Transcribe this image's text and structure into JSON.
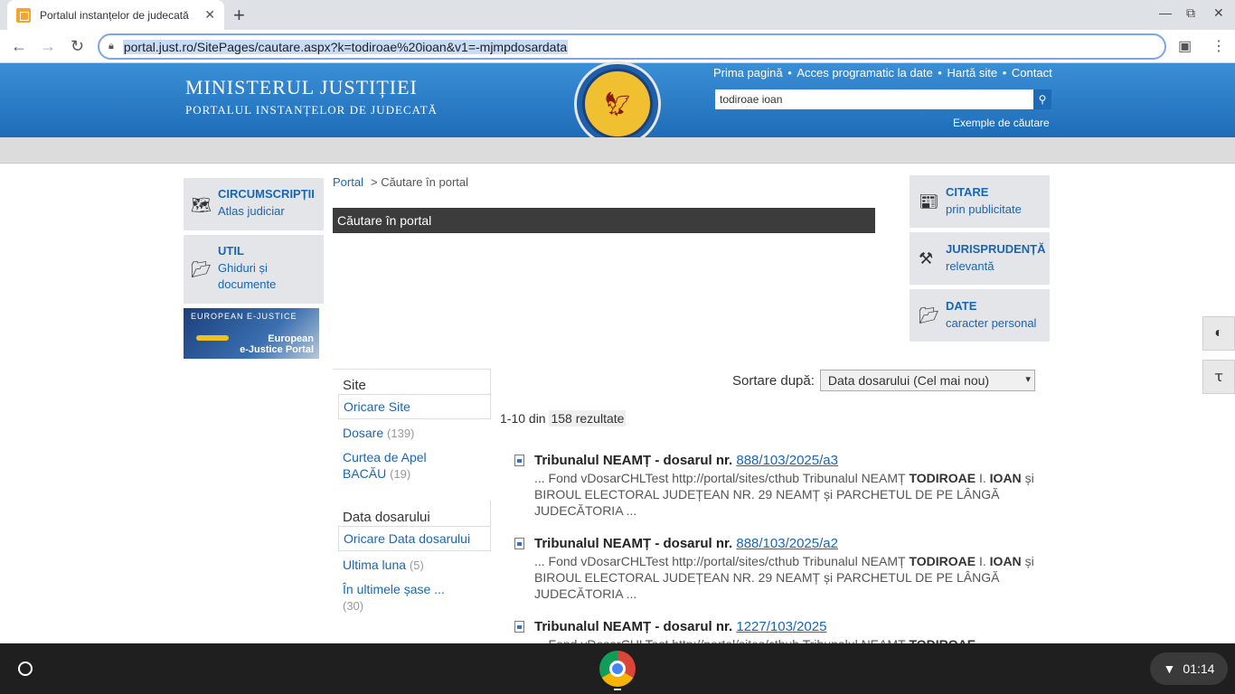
{
  "browser": {
    "tab_title": "Portalul instanțelor de judecată",
    "tab_close": "✕",
    "new_tab": "+",
    "minimize": "—",
    "maximize": "⧉",
    "close": "✕",
    "back": "←",
    "forward": "→",
    "reload": "↻",
    "url": "portal.just.ro/SitePages/cautare.aspx?k=todiroae%20ioan&v1=-mjmpdosardata",
    "menu": "⋮",
    "profile": "▣"
  },
  "header": {
    "title1": "MINISTERUL JUSTIȚIEI",
    "title2": "PORTALUL INSTANȚELOR DE JUDECATĂ",
    "toplinks": [
      "Prima pagină",
      "Acces programatic la date",
      "Hartă site",
      "Contact"
    ],
    "separator": " • ",
    "search_value": "todiroae ioan",
    "search_icon": "⚲",
    "examples": "Exemple de căutare"
  },
  "left": {
    "circ_title": "CIRCUMSCRIPȚII",
    "circ_sub": "Atlas judiciar",
    "util_title": "UTIL",
    "util_sub": "Ghiduri și documente",
    "ej_logo": "EUROPEAN E-JUSTICE",
    "ej_name1": "European",
    "ej_name2": "e-Justice Portal"
  },
  "center": {
    "breadcrumb_home": "Portal",
    "breadcrumb_sep": ">",
    "breadcrumb_current": "Căutare în portal",
    "section_title": "Căutare în portal"
  },
  "right": {
    "citare_title": "CITARE",
    "citare_sub": "prin publicitate",
    "juris_title": "JURISPRUDENȚĂ",
    "juris_sub": "relevantă",
    "date_title": "DATE",
    "date_sub": "caracter personal"
  },
  "tools": {
    "contrast": "◐",
    "fontsize": "ꚍ"
  },
  "refiners": {
    "site_head": "Site",
    "site_selected": "Oricare Site",
    "site_items": [
      {
        "label": "Dosare",
        "count": "(139)"
      },
      {
        "label": "Curtea de Apel BACĂU",
        "count": "(19)"
      }
    ],
    "date_head": "Data dosarului",
    "date_selected": "Oricare Data dosarului",
    "date_items": [
      {
        "label": "Ultima luna",
        "count": "(5)"
      },
      {
        "label": "În ultimele șase ...",
        "count": "(30)"
      }
    ]
  },
  "results": {
    "sort_label": "Sortare după:",
    "sort_value": "Data dosarului (Cel mai nou)",
    "count_prefix": "1-10 din",
    "count_total": "158 rezultate",
    "items": [
      {
        "title": "Tribunalul NEAMȚ - dosarul nr.",
        "link": "888/103/2025/a3",
        "snip1": "... Fond vDosarCHLTest http://portal/sites/cthub Tribunalul NEAMȚ",
        "b1": "TODIROAE",
        "snip2": "I.",
        "b2": "IOAN",
        "snip3": "și BIROUL ELECTORAL JUDEȚEAN NR. 29 NEAMȚ și PARCHETUL DE PE LÂNGĂ JUDECĂTORIA ..."
      },
      {
        "title": "Tribunalul NEAMȚ - dosarul nr.",
        "link": "888/103/2025/a2",
        "snip1": "... Fond vDosarCHLTest http://portal/sites/cthub Tribunalul NEAMȚ",
        "b1": "TODIROAE",
        "snip2": "I.",
        "b2": "IOAN",
        "snip3": "și BIROUL ELECTORAL JUDEȚEAN NR. 29 NEAMȚ și PARCHETUL DE PE LÂNGĂ JUDECĂTORIA ..."
      },
      {
        "title": "Tribunalul NEAMȚ - dosarul nr.",
        "link": "1227/103/2025",
        "snip1": "... Fond vDosarCHLTest http://portal/sites/cthub Tribunalul NEAMȚ",
        "b1": "TODIROAE"
      }
    ]
  },
  "taskbar": {
    "time": "01:14",
    "wifi": "▼"
  }
}
